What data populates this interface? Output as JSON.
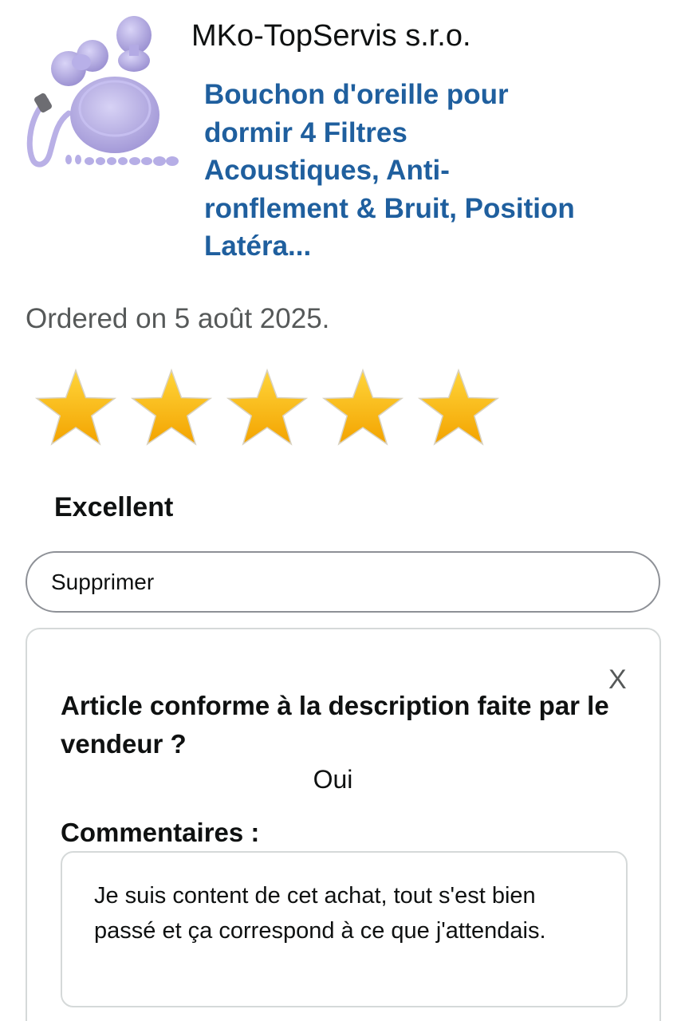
{
  "product": {
    "seller": "MKo-TopServis s.r.o.",
    "title": "Bouchon d'oreille pour dormir 4 Filtres Acoustiques, Anti-ronflement & Bruit, Position Latéra...",
    "image_name": "purple-earplugs-with-case"
  },
  "order": {
    "date_text": "Ordered on 5 août 2025."
  },
  "rating": {
    "stars_filled": 5,
    "stars_total": 5,
    "label": "Excellent",
    "star_color": "#f7b500"
  },
  "actions": {
    "delete_label": "Supprimer"
  },
  "feedback": {
    "close_label": "X",
    "question": "Article conforme à la description faite par le vendeur ?",
    "answer": "Oui",
    "comments_label": "Commentaires :",
    "comment_text": "Je suis content de cet achat, tout s'est bien passé et ça correspond à ce que j'attendais."
  },
  "colors": {
    "link_blue": "#1f5f9e",
    "muted_gray": "#565959"
  }
}
